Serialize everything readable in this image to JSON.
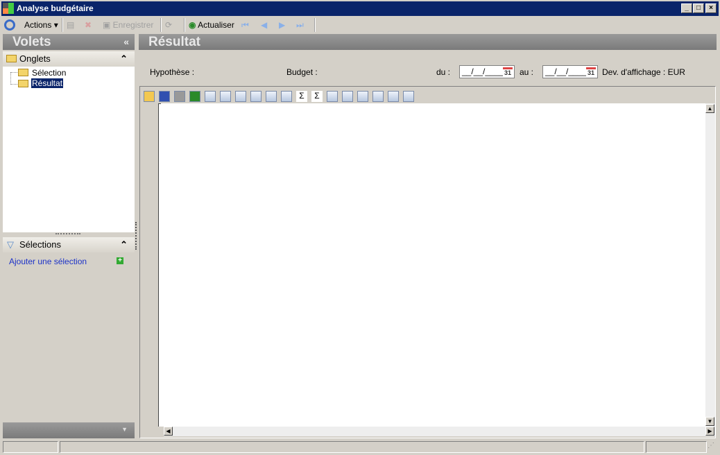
{
  "window": {
    "title": "Analyse budgétaire"
  },
  "toolbar": {
    "actions": "Actions",
    "save": "Enregistrer",
    "refresh": "Actualiser"
  },
  "left": {
    "title": "Volets",
    "collapse": "«",
    "tabs_section": "Onglets",
    "tree": [
      "Sélection",
      "Résultat"
    ],
    "selections_section": "Sélections",
    "add_selection": "Ajouter une sélection",
    "expand": "⌃"
  },
  "main": {
    "title": "Résultat",
    "hypothesis_label": "Hypothèse :",
    "budget_label": "Budget :",
    "from_label": "du :",
    "from_value": "__/__/____",
    "to_label": "au :",
    "to_value": "__/__/____",
    "calendar_day": "31",
    "currency": "Dev. d'affichage : EUR"
  },
  "grid_toolbar": [
    "open-icon",
    "save-icon",
    "print-icon",
    "excel-icon",
    "rows-icon",
    "columns-icon",
    "grid-icon",
    "grid-lines-icon",
    "grid-dots-icon",
    "pivot-icon",
    "sum-icon",
    "add-sum-icon",
    "fit-width-icon",
    "row-layout-icon",
    "column-layout-icon",
    "cross-layout-icon",
    "expand-all-icon",
    "collapse-all-icon"
  ]
}
